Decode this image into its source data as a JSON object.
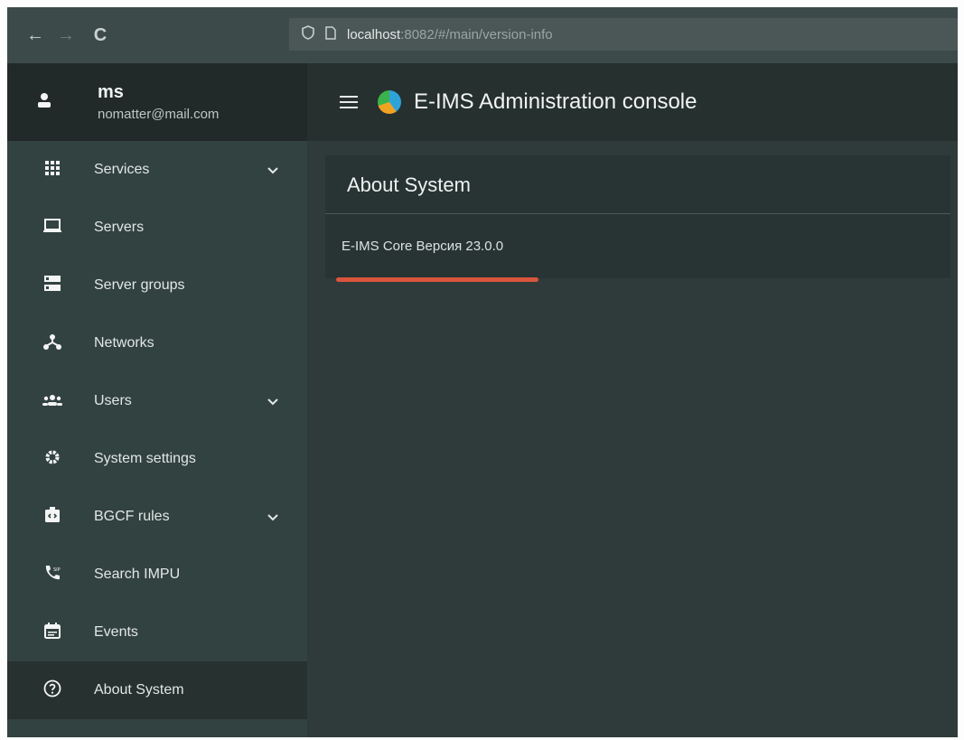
{
  "browser": {
    "back": "←",
    "forward": "→",
    "reload": "C",
    "url_host": "localhost",
    "url_rest": ":8082/#/main/version-info"
  },
  "user": {
    "name": "ms",
    "email": "nomatter@mail.com"
  },
  "header": {
    "title": "E-IMS Administration console"
  },
  "sidebar": {
    "items": [
      {
        "label": "Services",
        "icon": "grid-icon",
        "expandable": true
      },
      {
        "label": "Servers",
        "icon": "laptop-icon",
        "expandable": false
      },
      {
        "label": "Server groups",
        "icon": "storage-icon",
        "expandable": false
      },
      {
        "label": "Networks",
        "icon": "network-icon",
        "expandable": false
      },
      {
        "label": "Users",
        "icon": "people-icon",
        "expandable": true
      },
      {
        "label": "System settings",
        "icon": "gear-icon",
        "expandable": false
      },
      {
        "label": "BGCF rules",
        "icon": "rules-icon",
        "expandable": true
      },
      {
        "label": "Search IMPU",
        "icon": "sip-phone-icon",
        "expandable": false
      },
      {
        "label": "Events",
        "icon": "calendar-icon",
        "expandable": false
      },
      {
        "label": "About System",
        "icon": "help-circle-icon",
        "expandable": false,
        "active": true
      }
    ]
  },
  "main": {
    "card_title": "About System",
    "version_text": "E-IMS Core Версия 23.0.0"
  },
  "colors": {
    "underline": "#d9553c",
    "sidebar_bg": "#324241",
    "header_bg": "#26302f"
  }
}
